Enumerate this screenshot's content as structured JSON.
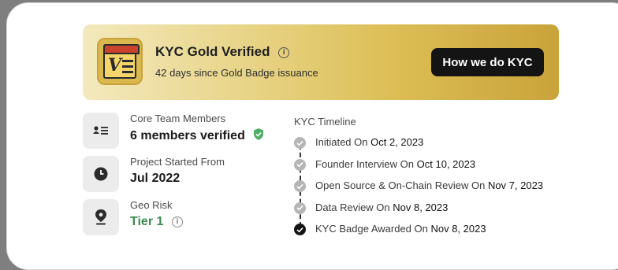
{
  "banner": {
    "title": "KYC Gold Verified",
    "info_glyph": "i",
    "subtitle": "42 days since Gold Badge issuance",
    "button_label": "How we do KYC",
    "badge_letter": "V"
  },
  "stats": [
    {
      "label": "Core Team Members",
      "value": "6 members verified",
      "icon": "id-card-icon"
    },
    {
      "label": "Project Started From",
      "value": "Jul 2022",
      "icon": "clock-icon"
    },
    {
      "label": "Geo Risk",
      "value": "Tier 1",
      "icon": "map-pin-icon"
    }
  ],
  "timeline": {
    "title": "KYC Timeline",
    "items": [
      {
        "label": "Initiated On ",
        "date": "Oct 2, 2023",
        "status": "complete"
      },
      {
        "label": "Founder Interview On ",
        "date": "Oct 10, 2023",
        "status": "complete"
      },
      {
        "label": "Open Source & On-Chain Review On ",
        "date": "Nov 7, 2023",
        "status": "complete"
      },
      {
        "label": "Data Review On ",
        "date": "Nov 8, 2023",
        "status": "complete"
      },
      {
        "label": "KYC Badge Awarded On ",
        "date": "Nov 8, 2023",
        "status": "final"
      }
    ]
  },
  "colors": {
    "verified_green": "#4caf63",
    "tier_green": "#3a8a4e",
    "button_bg": "#141414",
    "gold_start": "#f3e9bd",
    "gold_end": "#c9a33a"
  }
}
